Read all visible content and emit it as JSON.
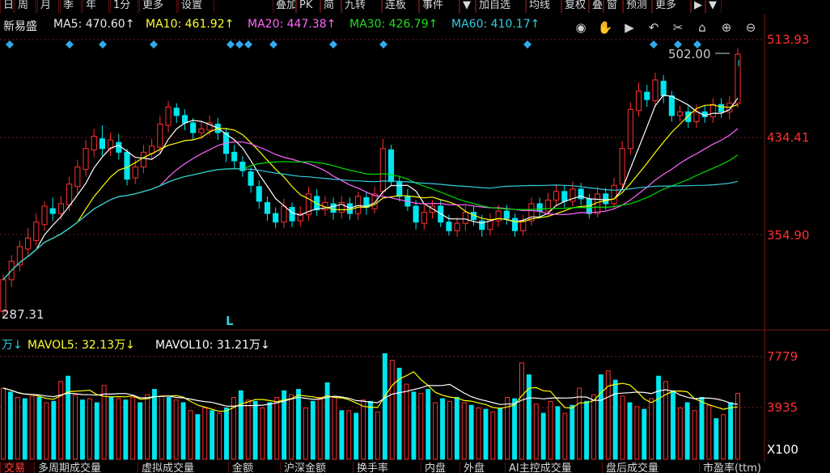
{
  "topbar": {
    "left_tabs": [
      "日",
      "周",
      "月",
      "季",
      "年",
      "1分",
      "更多",
      "设置"
    ],
    "right_tabs": [
      "叠加",
      "PK",
      "简",
      "九转",
      "连板",
      "事件",
      "▼",
      "加自选",
      "均线",
      "复权",
      "叠",
      "窗",
      "预测",
      "更多",
      "▶",
      "▼"
    ]
  },
  "legend": {
    "name": "新易盛",
    "ma5": "MA5: 470.60↑",
    "ma10": "MA10: 461.92↑",
    "ma20": "MA20: 447.38↑",
    "ma30": "MA30: 426.79↑",
    "ma60": "MA60: 410.17↑"
  },
  "toolbar_icons": [
    "eye-icon",
    "hand-icon",
    "play-icon",
    "undo-icon",
    "scissors-icon",
    "lock-icon",
    "zoom-in-icon",
    "zoom-out-icon"
  ],
  "price_axis": {
    "top": "513.93",
    "mid": "434.41",
    "low": "354.90"
  },
  "last_price_label": "502.00",
  "low_price_label": "287.31",
  "marker_L": "L",
  "volume_legend": {
    "vol": "万↓",
    "mavol5": "MAVOL5: 32.13万↓",
    "mavol10": "MAVOL10: 31.21万↓"
  },
  "volume_axis": {
    "top": "7779",
    "mid": "3935",
    "unit": "X100"
  },
  "bottom_tabs": [
    "交易",
    "多周期成交量",
    "虚拟成交量",
    "金额",
    "沪深金额",
    "换手率",
    "内盘",
    "外盘",
    "AI主控成交量",
    "盘后成交量",
    "市盈率(ttm)"
  ],
  "colors": {
    "up": "#ff3030",
    "down": "#00e5ee",
    "ma5": "#ffffff",
    "ma10": "#ffff00",
    "ma20": "#ff66ff",
    "ma30": "#00dd00",
    "ma60": "#33ccdd",
    "grid_red": "#7a1a1a"
  },
  "chart_data": {
    "type": "candlestick",
    "price_ticks": [
      513.93,
      434.41,
      354.9
    ],
    "price_range": [
      287.31,
      513.93
    ],
    "volume_ticks": [
      7779,
      3935
    ],
    "volume_unit": "X100",
    "candles": [
      {
        "o": 292,
        "c": 318,
        "h": 322,
        "l": 287
      },
      {
        "o": 318,
        "c": 333,
        "h": 338,
        "l": 312
      },
      {
        "o": 330,
        "c": 345,
        "h": 350,
        "l": 325
      },
      {
        "o": 343,
        "c": 352,
        "h": 360,
        "l": 338
      },
      {
        "o": 350,
        "c": 365,
        "h": 372,
        "l": 346
      },
      {
        "o": 363,
        "c": 378,
        "h": 382,
        "l": 358
      },
      {
        "o": 376,
        "c": 372,
        "h": 385,
        "l": 366
      },
      {
        "o": 372,
        "c": 380,
        "h": 386,
        "l": 367
      },
      {
        "o": 379,
        "c": 396,
        "h": 402,
        "l": 374
      },
      {
        "o": 394,
        "c": 410,
        "h": 416,
        "l": 388
      },
      {
        "o": 408,
        "c": 425,
        "h": 432,
        "l": 402
      },
      {
        "o": 424,
        "c": 435,
        "h": 441,
        "l": 418
      },
      {
        "o": 433,
        "c": 425,
        "h": 444,
        "l": 419
      },
      {
        "o": 425,
        "c": 432,
        "h": 438,
        "l": 419
      },
      {
        "o": 430,
        "c": 422,
        "h": 437,
        "l": 416
      },
      {
        "o": 422,
        "c": 400,
        "h": 425,
        "l": 395
      },
      {
        "o": 401,
        "c": 410,
        "h": 416,
        "l": 396
      },
      {
        "o": 410,
        "c": 422,
        "h": 428,
        "l": 405
      },
      {
        "o": 421,
        "c": 427,
        "h": 433,
        "l": 416
      },
      {
        "o": 426,
        "c": 445,
        "h": 452,
        "l": 421
      },
      {
        "o": 444,
        "c": 459,
        "h": 464,
        "l": 438
      },
      {
        "o": 458,
        "c": 452,
        "h": 462,
        "l": 446
      },
      {
        "o": 452,
        "c": 446,
        "h": 457,
        "l": 440
      },
      {
        "o": 446,
        "c": 438,
        "h": 450,
        "l": 432
      },
      {
        "o": 438,
        "c": 441,
        "h": 447,
        "l": 433
      },
      {
        "o": 440,
        "c": 446,
        "h": 452,
        "l": 436
      },
      {
        "o": 445,
        "c": 438,
        "h": 450,
        "l": 432
      },
      {
        "o": 438,
        "c": 421,
        "h": 442,
        "l": 414
      },
      {
        "o": 422,
        "c": 415,
        "h": 428,
        "l": 409
      },
      {
        "o": 414,
        "c": 407,
        "h": 419,
        "l": 402
      },
      {
        "o": 406,
        "c": 395,
        "h": 410,
        "l": 389
      },
      {
        "o": 394,
        "c": 382,
        "h": 399,
        "l": 376
      },
      {
        "o": 381,
        "c": 372,
        "h": 386,
        "l": 366
      },
      {
        "o": 372,
        "c": 365,
        "h": 377,
        "l": 360
      },
      {
        "o": 365,
        "c": 378,
        "h": 384,
        "l": 360
      },
      {
        "o": 377,
        "c": 366,
        "h": 381,
        "l": 361
      },
      {
        "o": 366,
        "c": 372,
        "h": 378,
        "l": 361
      },
      {
        "o": 371,
        "c": 388,
        "h": 394,
        "l": 366
      },
      {
        "o": 386,
        "c": 375,
        "h": 392,
        "l": 370
      },
      {
        "o": 375,
        "c": 381,
        "h": 386,
        "l": 370
      },
      {
        "o": 380,
        "c": 373,
        "h": 385,
        "l": 367
      },
      {
        "o": 373,
        "c": 381,
        "h": 386,
        "l": 368
      },
      {
        "o": 380,
        "c": 372,
        "h": 385,
        "l": 367
      },
      {
        "o": 372,
        "c": 386,
        "h": 390,
        "l": 367
      },
      {
        "o": 385,
        "c": 377,
        "h": 390,
        "l": 371
      },
      {
        "o": 376,
        "c": 388,
        "h": 394,
        "l": 372
      },
      {
        "o": 390,
        "c": 425,
        "h": 433,
        "l": 387
      },
      {
        "o": 424,
        "c": 398,
        "h": 428,
        "l": 395
      },
      {
        "o": 398,
        "c": 386,
        "h": 402,
        "l": 382
      },
      {
        "o": 386,
        "c": 378,
        "h": 392,
        "l": 374
      },
      {
        "o": 378,
        "c": 365,
        "h": 383,
        "l": 359
      },
      {
        "o": 364,
        "c": 373,
        "h": 379,
        "l": 359
      },
      {
        "o": 373,
        "c": 378,
        "h": 383,
        "l": 368
      },
      {
        "o": 378,
        "c": 365,
        "h": 383,
        "l": 361
      },
      {
        "o": 365,
        "c": 358,
        "h": 371,
        "l": 354
      },
      {
        "o": 358,
        "c": 364,
        "h": 369,
        "l": 353
      },
      {
        "o": 364,
        "c": 373,
        "h": 378,
        "l": 358
      },
      {
        "o": 373,
        "c": 367,
        "h": 378,
        "l": 362
      },
      {
        "o": 366,
        "c": 359,
        "h": 371,
        "l": 353
      },
      {
        "o": 359,
        "c": 367,
        "h": 372,
        "l": 354
      },
      {
        "o": 366,
        "c": 374,
        "h": 379,
        "l": 361
      },
      {
        "o": 374,
        "c": 368,
        "h": 379,
        "l": 363
      },
      {
        "o": 368,
        "c": 358,
        "h": 372,
        "l": 353
      },
      {
        "o": 358,
        "c": 366,
        "h": 371,
        "l": 354
      },
      {
        "o": 366,
        "c": 380,
        "h": 385,
        "l": 362
      },
      {
        "o": 380,
        "c": 374,
        "h": 385,
        "l": 368
      },
      {
        "o": 374,
        "c": 383,
        "h": 389,
        "l": 370
      },
      {
        "o": 383,
        "c": 390,
        "h": 395,
        "l": 378
      },
      {
        "o": 390,
        "c": 382,
        "h": 395,
        "l": 377
      },
      {
        "o": 382,
        "c": 392,
        "h": 398,
        "l": 378
      },
      {
        "o": 392,
        "c": 384,
        "h": 397,
        "l": 379
      },
      {
        "o": 384,
        "c": 372,
        "h": 388,
        "l": 368
      },
      {
        "o": 372,
        "c": 388,
        "h": 394,
        "l": 369
      },
      {
        "o": 388,
        "c": 380,
        "h": 393,
        "l": 375
      },
      {
        "o": 380,
        "c": 395,
        "h": 401,
        "l": 376
      },
      {
        "o": 396,
        "c": 425,
        "h": 431,
        "l": 392
      },
      {
        "o": 425,
        "c": 457,
        "h": 463,
        "l": 420
      },
      {
        "o": 456,
        "c": 472,
        "h": 479,
        "l": 451
      },
      {
        "o": 471,
        "c": 465,
        "h": 477,
        "l": 459
      },
      {
        "o": 464,
        "c": 481,
        "h": 487,
        "l": 459
      },
      {
        "o": 480,
        "c": 468,
        "h": 485,
        "l": 462
      },
      {
        "o": 468,
        "c": 452,
        "h": 472,
        "l": 447
      },
      {
        "o": 452,
        "c": 455,
        "h": 460,
        "l": 447
      },
      {
        "o": 455,
        "c": 447,
        "h": 460,
        "l": 442
      },
      {
        "o": 447,
        "c": 455,
        "h": 461,
        "l": 442
      },
      {
        "o": 455,
        "c": 451,
        "h": 460,
        "l": 446
      },
      {
        "o": 451,
        "c": 461,
        "h": 466,
        "l": 446
      },
      {
        "o": 461,
        "c": 455,
        "h": 466,
        "l": 450
      },
      {
        "o": 455,
        "c": 462,
        "h": 468,
        "l": 449
      },
      {
        "o": 462,
        "c": 502,
        "h": 507,
        "l": 458
      }
    ],
    "volumes": [
      5400,
      5100,
      4700,
      4600,
      4800,
      4700,
      4300,
      4400,
      5900,
      6300,
      4900,
      4500,
      4600,
      4300,
      5600,
      4700,
      4600,
      4500,
      4700,
      4300,
      4900,
      5300,
      4800,
      4700,
      4500,
      4300,
      3700,
      3400,
      3900,
      3700,
      3500,
      3900,
      4700,
      5200,
      4500,
      4400,
      3900,
      4300,
      4700,
      5200,
      4900,
      5300,
      3900,
      4400,
      4700,
      5800,
      4700,
      3700,
      3700,
      3500,
      4500,
      4400,
      3600,
      8000,
      7500,
      6900,
      5700,
      5100,
      5000,
      5300,
      4300,
      4600,
      4400,
      4700,
      4300,
      4100,
      3900,
      3800,
      3600,
      3900,
      4700,
      4600,
      7300,
      6400,
      4200,
      3500,
      4400,
      4000,
      3500,
      4100,
      5400,
      4400,
      4900,
      6400,
      6700,
      6000,
      4800,
      4300,
      4000,
      3800,
      4600,
      6300,
      5900,
      5200,
      3900,
      4300,
      3700,
      4700,
      4100,
      3100,
      3400,
      4300,
      5000
    ],
    "volume_up_pattern": "alternating"
  }
}
